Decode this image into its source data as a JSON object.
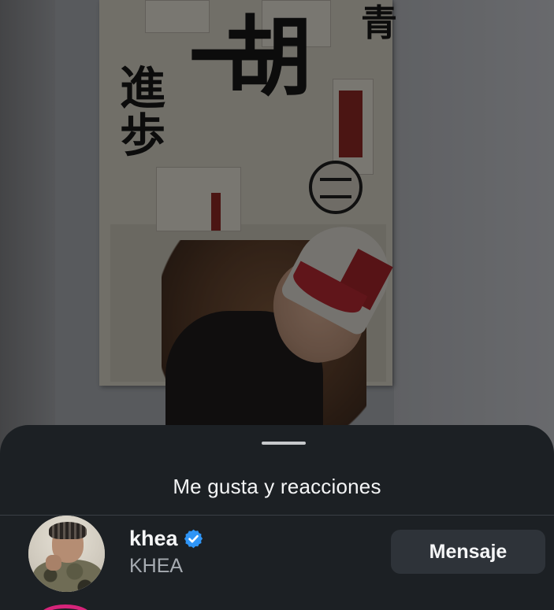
{
  "background": {
    "description_icon": "photo-backdrop"
  },
  "sheet": {
    "title": "Me gusta y reacciones",
    "users": [
      {
        "username": "khea",
        "verified": true,
        "full_name": "KHEA",
        "action_label": "Mensaje"
      }
    ]
  },
  "colors": {
    "sheet_bg": "#1c2024",
    "button_bg": "#2e3339",
    "verified": "#2f95f6",
    "story_ring": "#d6247a"
  }
}
